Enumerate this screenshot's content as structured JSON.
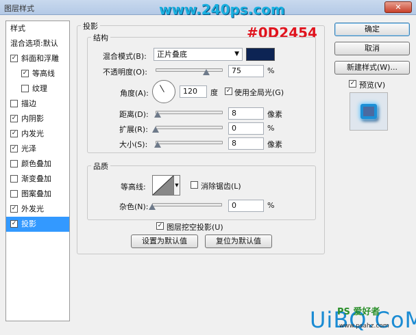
{
  "window": {
    "title": "图层样式",
    "close_label": "✕"
  },
  "watermarks": {
    "top_site": "www.240ps.com",
    "hex_color": "#0D2454",
    "bottom_logo": "UiBQ.CoM",
    "bottom_ps": "PS 爱好者",
    "bottom_site": "www.psahz.com"
  },
  "left_panel": {
    "items": [
      {
        "label": "样式",
        "checkbox": false
      },
      {
        "label": "混合选项:默认",
        "checkbox": false
      },
      {
        "label": "斜面和浮雕",
        "checkbox": true,
        "checked": true
      },
      {
        "label": "等高线",
        "checkbox": true,
        "checked": true,
        "indent": true
      },
      {
        "label": "纹理",
        "checkbox": true,
        "checked": false,
        "indent": true
      },
      {
        "label": "描边",
        "checkbox": true,
        "checked": false
      },
      {
        "label": "内阴影",
        "checkbox": true,
        "checked": true
      },
      {
        "label": "内发光",
        "checkbox": true,
        "checked": true
      },
      {
        "label": "光泽",
        "checkbox": true,
        "checked": true
      },
      {
        "label": "颜色叠加",
        "checkbox": true,
        "checked": false
      },
      {
        "label": "渐变叠加",
        "checkbox": true,
        "checked": false
      },
      {
        "label": "图案叠加",
        "checkbox": true,
        "checked": false
      },
      {
        "label": "外发光",
        "checkbox": true,
        "checked": true
      },
      {
        "label": "投影",
        "checkbox": true,
        "checked": true,
        "selected": true
      }
    ]
  },
  "drop_shadow": {
    "section_title": "投影",
    "structure": {
      "title": "结构",
      "blend_mode_label": "混合模式(B):",
      "blend_mode_value": "正片叠底",
      "shadow_color": "#0d2454",
      "opacity_label": "不透明度(O):",
      "opacity_value": "75",
      "opacity_unit": "%",
      "opacity_fraction": 0.75,
      "angle_label": "角度(A):",
      "angle_value": "120",
      "angle_unit": "度",
      "global_light_label": "使用全局光(G)",
      "global_light_checked": true,
      "distance_label": "距离(D):",
      "distance_value": "8",
      "distance_unit": "像素",
      "distance_fraction": 0.03,
      "spread_label": "扩展(R):",
      "spread_value": "0",
      "spread_unit": "%",
      "spread_fraction": 0.0,
      "size_label": "大小(S):",
      "size_value": "8",
      "size_unit": "像素",
      "size_fraction": 0.03
    },
    "quality": {
      "title": "品质",
      "contour_label": "等高线:",
      "antialias_label": "消除锯齿(L)",
      "antialias_checked": false,
      "noise_label": "杂色(N):",
      "noise_value": "0",
      "noise_unit": "%",
      "noise_fraction": 0.0
    },
    "knockout_label": "图层挖空投影(U)",
    "knockout_checked": true,
    "make_default_label": "设置为默认值",
    "reset_default_label": "复位为默认值"
  },
  "right_buttons": {
    "ok_label": "确定",
    "cancel_label": "取消",
    "new_style_label": "新建样式(W)...",
    "preview_label": "预览(V)",
    "preview_checked": true
  }
}
